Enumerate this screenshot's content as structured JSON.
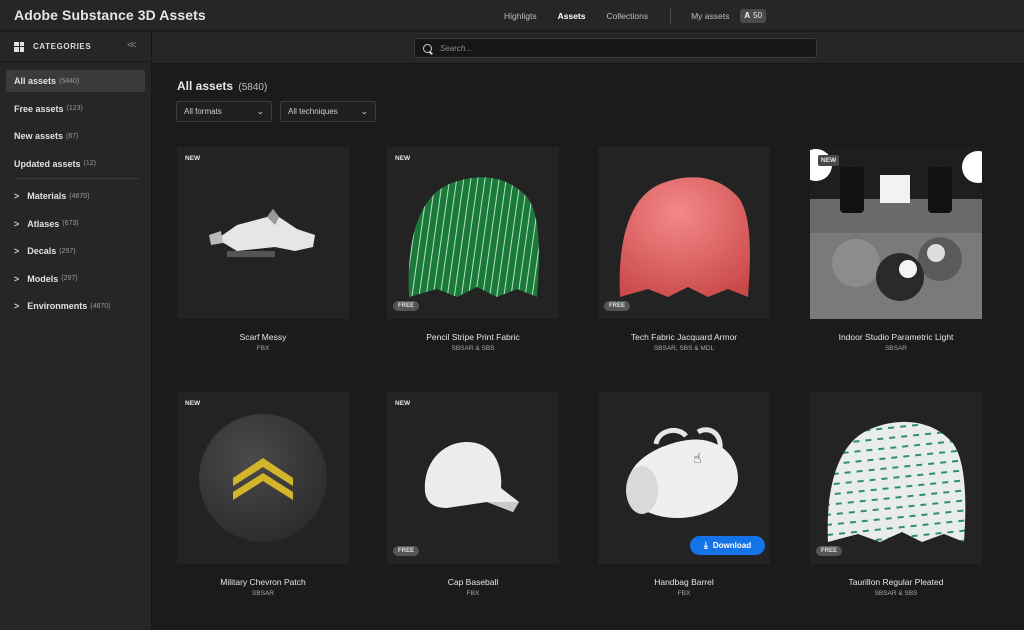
{
  "app": {
    "title": "Adobe Substance 3D Assets"
  },
  "nav": {
    "items": [
      {
        "label": "Highligts",
        "active": false
      },
      {
        "label": "Assets",
        "active": true
      },
      {
        "label": "Collections",
        "active": false
      }
    ],
    "my_assets": "My assets",
    "credits": {
      "icon": "adobe-icon",
      "icon_glyph": "A",
      "value": "50"
    }
  },
  "sidebar": {
    "header": "CATEGORIES",
    "collapse_glyph": "<<",
    "quick": [
      {
        "label": "All assets",
        "count": "(5840)",
        "active": true
      },
      {
        "label": "Free assets",
        "count": "(123)",
        "active": false
      },
      {
        "label": "New assets",
        "count": "(67)",
        "active": false
      },
      {
        "label": "Updated assets",
        "count": "(12)",
        "active": false
      }
    ],
    "categories": [
      {
        "label": "Materials",
        "count": "(4870)"
      },
      {
        "label": "Atlases",
        "count": "(673)"
      },
      {
        "label": "Decals",
        "count": "(297)"
      },
      {
        "label": "Models",
        "count": "(297)"
      },
      {
        "label": "Environments",
        "count": "(4870)"
      }
    ],
    "chevron": ">"
  },
  "search": {
    "placeholder": "Search..."
  },
  "main": {
    "heading": "All assets",
    "count": "(5840)",
    "filters": [
      {
        "label": "All formats"
      },
      {
        "label": "All techniques"
      }
    ],
    "caret": "⌄",
    "assets": [
      {
        "title": "Scarf Messy",
        "formats": "FBX",
        "new": "NEW",
        "free": "",
        "art": "scarf"
      },
      {
        "title": "Pencil Stripe Print Fabric",
        "formats": "SBSAR & SBS",
        "new": "NEW",
        "free": "FREE",
        "art": "green"
      },
      {
        "title": "Tech Fabric Jacquard Armor",
        "formats": "SBSAR, SBS & MDL",
        "new": "",
        "free": "FREE",
        "art": "red"
      },
      {
        "title": "Indoor Studio Parametric Light",
        "formats": "SBSAR",
        "new": "NEW",
        "free": "",
        "art": "studio"
      },
      {
        "title": "Military Chevron Patch",
        "formats": "SBSAR",
        "new": "NEW",
        "free": "",
        "art": "chevron"
      },
      {
        "title": "Cap Baseball",
        "formats": "FBX",
        "new": "NEW",
        "free": "FREE",
        "art": "cap"
      },
      {
        "title": "Handbag Barrel",
        "formats": "FBX",
        "new": "",
        "free": "",
        "art": "bag",
        "download": "Download"
      },
      {
        "title": "Taurillon Regular Pleated",
        "formats": "SBSAR & SBS",
        "new": "",
        "free": "FREE",
        "art": "pleated"
      }
    ]
  },
  "colors": {
    "accent": "#1473e6",
    "bg": "#1b1b1b",
    "panel": "#262626"
  }
}
